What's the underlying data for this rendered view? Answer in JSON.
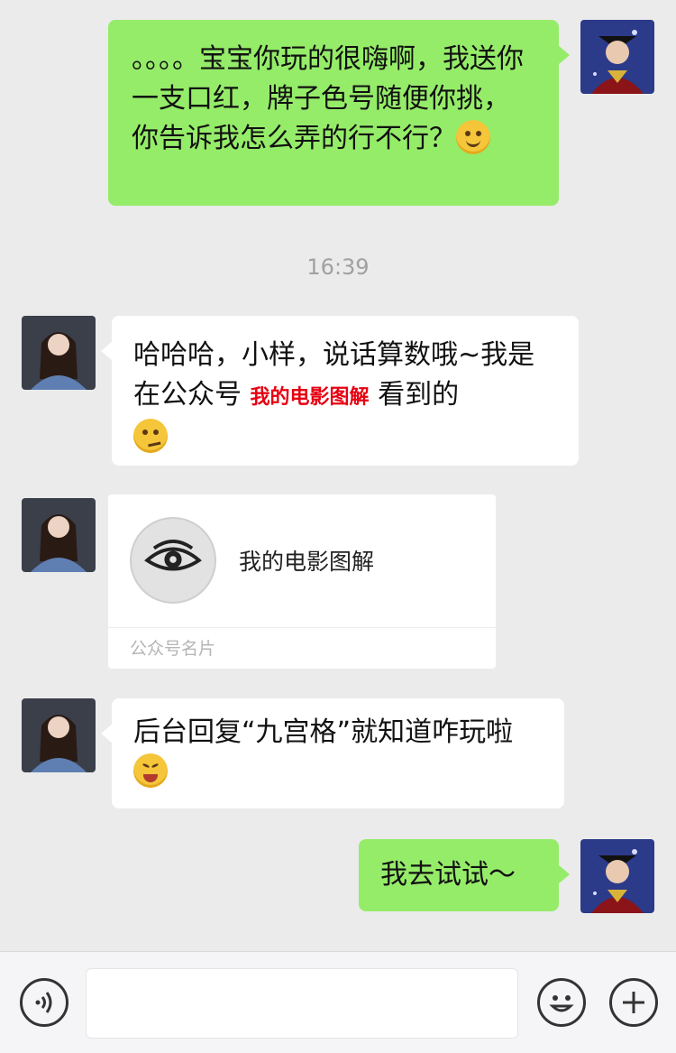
{
  "messages": [
    {
      "id": "m1",
      "side": "outgoing",
      "text": "。。。。宝宝你玩的很嗨啊，我送你一支口红，牌子色号随便你挑，你告诉我怎么弄的行不行？",
      "emoji": "facepalm-emoji"
    },
    {
      "id": "m2",
      "side": "incoming",
      "text_before": "哈哈哈，小样，说话算数哦~我是在公众号",
      "highlight": "我的电影图解",
      "text_after": "看到的",
      "emoji": "smirk-emoji"
    },
    {
      "id": "m3",
      "side": "incoming",
      "type": "official-account-card",
      "name": "我的电影图解",
      "label": "公众号名片"
    },
    {
      "id": "m4",
      "side": "incoming",
      "text": "后台回复“九宫格”就知道咋玩啦",
      "emoji": "tongue-out-emoji"
    },
    {
      "id": "m5",
      "side": "outgoing",
      "text": "我去试试～"
    }
  ],
  "timestamp": "16:39",
  "input_bar": {
    "voice_icon": "voice-icon",
    "emoji_icon": "emoji-icon",
    "plus_icon": "plus-icon",
    "text_value": ""
  },
  "colors": {
    "background": "#ebebeb",
    "outgoing_bubble": "#95ec69",
    "incoming_bubble": "#ffffff",
    "highlight_text": "#e60012"
  }
}
